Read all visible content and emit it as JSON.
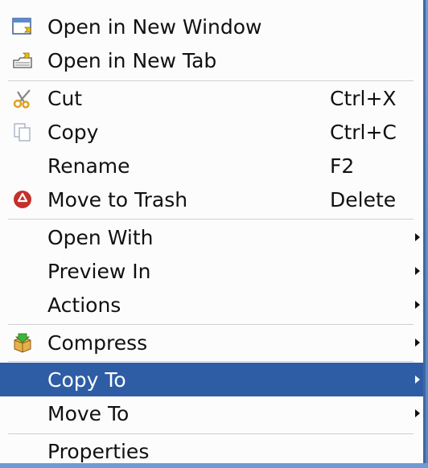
{
  "menu": {
    "items": [
      {
        "label": "Open in New Window",
        "shortcut": "",
        "icon": "window-icon",
        "submenu": false
      },
      {
        "label": "Open in New Tab",
        "shortcut": "",
        "icon": "tab-icon",
        "submenu": false
      },
      {
        "label": "Cut",
        "shortcut": "Ctrl+X",
        "icon": "scissors-icon",
        "submenu": false
      },
      {
        "label": "Copy",
        "shortcut": "Ctrl+C",
        "icon": "copy-icon",
        "submenu": false
      },
      {
        "label": "Rename",
        "shortcut": "F2",
        "icon": "",
        "submenu": false
      },
      {
        "label": "Move to Trash",
        "shortcut": "Delete",
        "icon": "trash-icon",
        "submenu": false
      },
      {
        "label": "Open With",
        "shortcut": "",
        "icon": "",
        "submenu": true
      },
      {
        "label": "Preview In",
        "shortcut": "",
        "icon": "",
        "submenu": true
      },
      {
        "label": "Actions",
        "shortcut": "",
        "icon": "",
        "submenu": true
      },
      {
        "label": "Compress",
        "shortcut": "",
        "icon": "compress-icon",
        "submenu": true
      },
      {
        "label": "Copy To",
        "shortcut": "",
        "icon": "",
        "submenu": true,
        "highlighted": true
      },
      {
        "label": "Move To",
        "shortcut": "",
        "icon": "",
        "submenu": true
      },
      {
        "label": "Properties",
        "shortcut": "",
        "icon": "",
        "submenu": false
      }
    ]
  },
  "colors": {
    "highlight": "#2f5da5",
    "menu_bg": "#fcfcfc",
    "desktop": "#5a86c0"
  }
}
